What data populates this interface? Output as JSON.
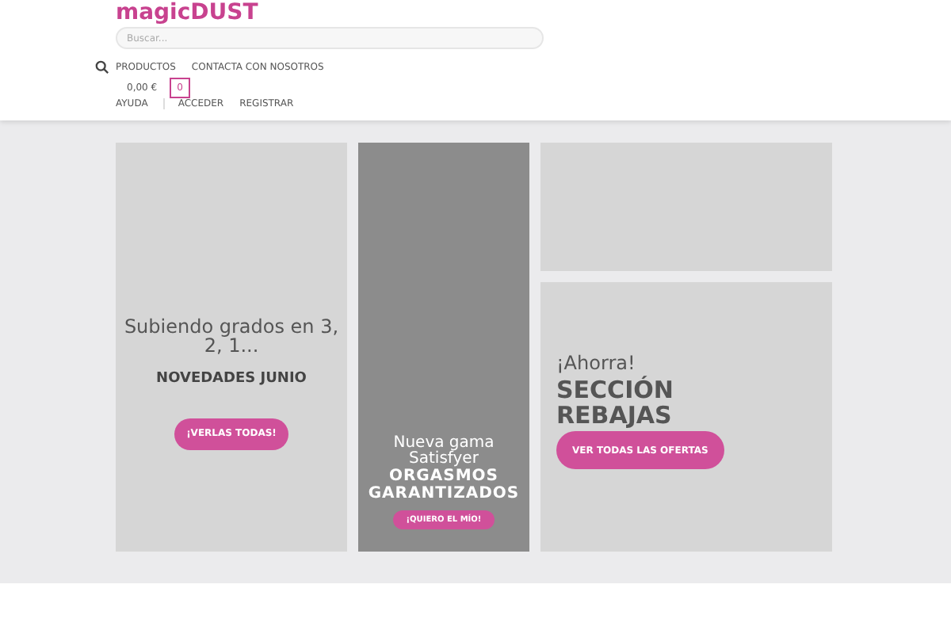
{
  "header": {
    "logo": "magicDUST",
    "search": {
      "placeholder": "Buscar..."
    },
    "nav": [
      "PRODUCTOS",
      "CONTACTA CON NOSOTROS"
    ],
    "cart": {
      "total": "0,00 €",
      "count": "0"
    },
    "links": [
      "AYUDA",
      "ACCEDER",
      "REGISTRAR"
    ]
  },
  "banners": [
    {
      "kind": "tall",
      "line": "Subiendo grados en 3, 2, 1...",
      "title": "NOVEDADES JUNIO",
      "button": "¡VERLAS TODAS!"
    },
    {
      "kind": "bottom",
      "line": "Nueva gama Satisfyer",
      "title": "ORGASMOS GARANTIZADOS",
      "button": "¡QUIERO EL MÍO!"
    },
    {
      "kind": "empty"
    },
    {
      "kind": "left",
      "line": "¡Ahorra!",
      "title": "SECCIÓN REBAJAS",
      "button": "VER TODAS LAS OFERTAS"
    }
  ]
}
